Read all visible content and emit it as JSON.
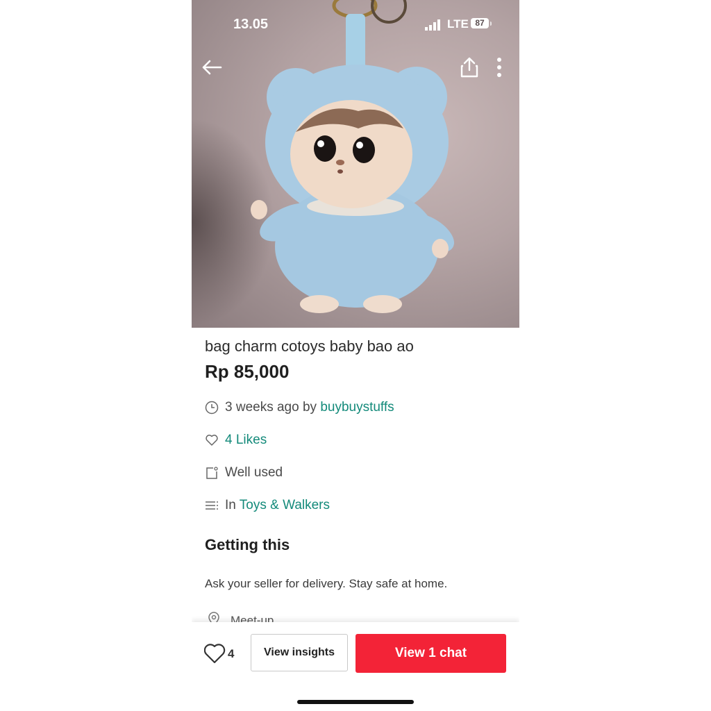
{
  "status_bar": {
    "time": "13.05",
    "network": "LTE",
    "battery": "87"
  },
  "listing": {
    "title": "bag charm cotoys baby bao ao",
    "price": "Rp 85,000",
    "posted_prefix": "3 weeks ago by",
    "seller": "buybuystuffs",
    "likes_label": "4 Likes",
    "condition": "Well used",
    "category_prefix": "In",
    "category": "Toys & Walkers"
  },
  "getting": {
    "heading": "Getting this",
    "note": "Ask your seller for delivery. Stay safe at home.",
    "meetup_label": "Meet-up"
  },
  "bottom_bar": {
    "like_count": "4",
    "insights_label": "View insights",
    "chat_label": "View 1 chat"
  },
  "icons": {
    "back": "back-arrow-icon",
    "share": "share-icon",
    "more": "more-vertical-icon",
    "clock": "clock-icon",
    "heart": "heart-icon",
    "condition": "tag-icon",
    "category": "list-icon",
    "location": "location-pin-icon"
  },
  "colors": {
    "accent_link": "#138a7a",
    "primary_button": "#f32337"
  }
}
